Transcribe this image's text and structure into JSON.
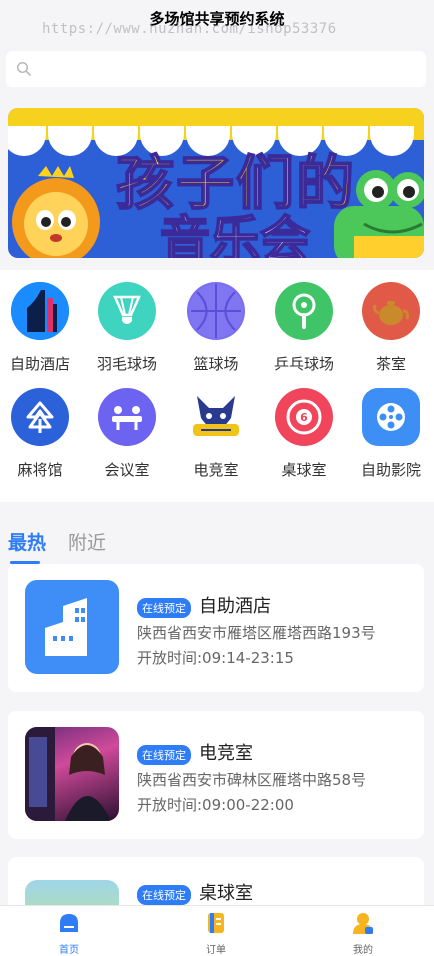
{
  "header": {
    "title": "多场馆共享预约系统",
    "watermark": "https://www.huzhan.com/ishop53376"
  },
  "search": {
    "icon": "search-icon",
    "placeholder": ""
  },
  "banner": {
    "line1": "孩子们的",
    "line2": "音乐会"
  },
  "categories": [
    {
      "label": "自助酒店",
      "icon": "hotel-building-icon",
      "color": "#1a8cff"
    },
    {
      "label": "羽毛球场",
      "icon": "shuttlecock-icon",
      "color": "#3fd4c0"
    },
    {
      "label": "篮球场",
      "icon": "basketball-icon",
      "color": "#7a6ff0"
    },
    {
      "label": "乒乓球场",
      "icon": "ping-pong-icon",
      "color": "#3fc567"
    },
    {
      "label": "茶室",
      "icon": "teapot-icon",
      "color": "#e05a47"
    },
    {
      "label": "麻将馆",
      "icon": "mahjong-tree-icon",
      "color": "#2b62d9"
    },
    {
      "label": "会议室",
      "icon": "meeting-table-icon",
      "color": "#6c63f0"
    },
    {
      "label": "电竞室",
      "icon": "esports-logo-icon",
      "color": "#2a3a8c"
    },
    {
      "label": "桌球室",
      "icon": "billiard-ball-icon",
      "color": "#f0455a"
    },
    {
      "label": "自助影院",
      "icon": "film-reel-icon",
      "color": "#3d8ef5"
    }
  ],
  "tabs": [
    {
      "label": "最热",
      "active": true
    },
    {
      "label": "附近",
      "active": false
    }
  ],
  "venues": [
    {
      "badge": "在线预定",
      "name": "自助酒店",
      "address": "陕西省西安市雁塔区雁塔西路193号",
      "hours": "开放时间:09:14-23:15",
      "thumb": "building-icon"
    },
    {
      "badge": "在线预定",
      "name": "电竞室",
      "address": "陕西省西安市碑林区雁塔中路58号",
      "hours": "开放时间:09:00-22:00",
      "thumb": "esports-photo"
    },
    {
      "badge": "在线预定",
      "name": "桌球室",
      "address": "",
      "hours": "",
      "thumb": "outdoor-photo"
    }
  ],
  "tabbar": [
    {
      "label": "首页",
      "icon": "home-icon",
      "active": true
    },
    {
      "label": "订单",
      "icon": "order-icon",
      "active": false
    },
    {
      "label": "我的",
      "icon": "user-icon",
      "active": false
    }
  ],
  "colors": {
    "accent": "#2f7df6",
    "background": "#f5f5f7"
  }
}
